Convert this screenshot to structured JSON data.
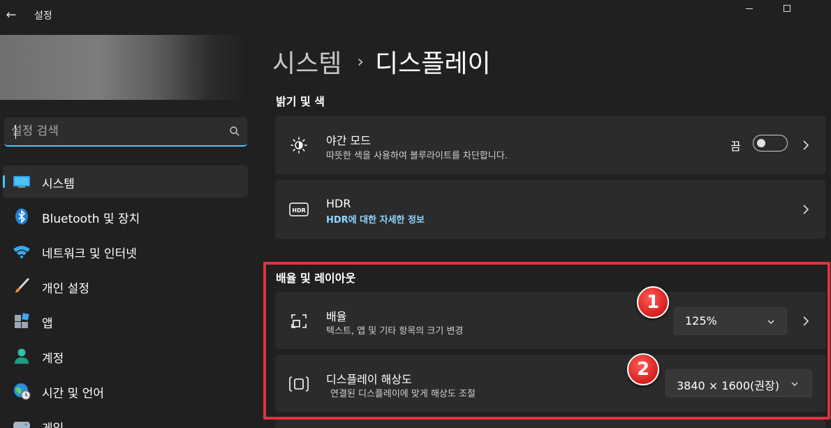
{
  "window": {
    "back_glyph": "←",
    "title": "설정"
  },
  "sidebar": {
    "search": {
      "placeholder": "설정 검색"
    },
    "items": [
      {
        "label": "시스템",
        "icon": "monitor-icon",
        "active": true
      },
      {
        "label": "Bluetooth 및 장치",
        "icon": "bluetooth-icon"
      },
      {
        "label": "네트워크 및 인터넷",
        "icon": "wifi-icon"
      },
      {
        "label": "개인 설정",
        "icon": "paintbrush-icon"
      },
      {
        "label": "앱",
        "icon": "apps-icon"
      },
      {
        "label": "계정",
        "icon": "person-icon"
      },
      {
        "label": "시간 및 언어",
        "icon": "globe-clock-icon"
      },
      {
        "label": "게임",
        "icon": "gamepad-icon"
      }
    ]
  },
  "main": {
    "breadcrumb": {
      "parent": "시스템",
      "separator": "›",
      "current": "디스플레이"
    },
    "section_brightness": {
      "title": "밝기 및 색",
      "night_light": {
        "title": "야간 모드",
        "subtitle": "따뜻한 색을 사용하여 블루라이트를 차단합니다.",
        "state": "끔",
        "enabled": false
      },
      "hdr": {
        "title": "HDR",
        "link": "HDR에 대한 자세한 정보"
      }
    },
    "section_scale": {
      "title": "배율 및 레이아웃",
      "scale": {
        "title": "배율",
        "subtitle": "텍스트, 앱 및 기타 항목의 크기 변경",
        "value": "125%"
      },
      "resolution": {
        "title": "디스플레이 해상도",
        "subtitle": "연결된 디스플레이에 맞게 해상도 조절",
        "value": "3840 × 1600(권장)"
      }
    },
    "annotations": {
      "badge_1": "1",
      "badge_2": "2",
      "highlight_color": "#e2333c"
    }
  },
  "colors": {
    "background": "#202020",
    "card": "#2b2b2b",
    "accent": "#4cc2ff",
    "link": "#8fd6ff"
  }
}
